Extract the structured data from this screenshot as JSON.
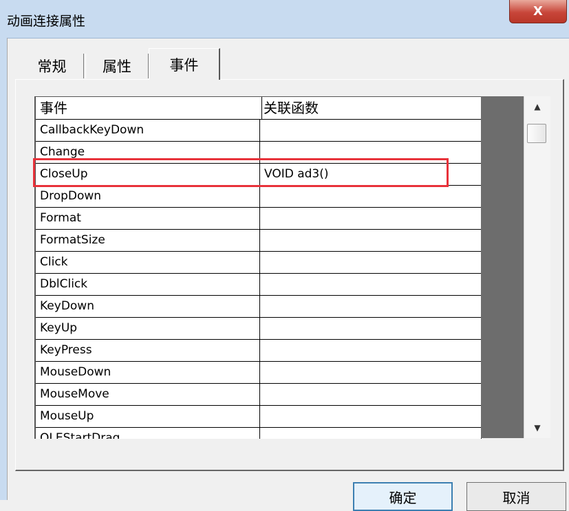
{
  "window": {
    "title": "动画连接属性",
    "close_label": "X"
  },
  "tabs": [
    {
      "label": "常规",
      "active": false
    },
    {
      "label": "属性",
      "active": false
    },
    {
      "label": "事件",
      "active": true
    }
  ],
  "grid": {
    "headers": [
      "事件",
      "关联函数"
    ],
    "rows": [
      {
        "event": "CallbackKeyDown",
        "func": ""
      },
      {
        "event": "Change",
        "func": ""
      },
      {
        "event": "CloseUp",
        "func": "VOID ad3()"
      },
      {
        "event": "DropDown",
        "func": ""
      },
      {
        "event": "Format",
        "func": ""
      },
      {
        "event": "FormatSize",
        "func": ""
      },
      {
        "event": "Click",
        "func": ""
      },
      {
        "event": "DblClick",
        "func": ""
      },
      {
        "event": "KeyDown",
        "func": ""
      },
      {
        "event": "KeyUp",
        "func": ""
      },
      {
        "event": "KeyPress",
        "func": ""
      },
      {
        "event": "MouseDown",
        "func": ""
      },
      {
        "event": "MouseMove",
        "func": ""
      },
      {
        "event": "MouseUp",
        "func": ""
      },
      {
        "event": "OLEStartDrag",
        "func": ""
      }
    ]
  },
  "scrollbar": {
    "up_icon": "arrow-up-icon",
    "down_icon": "arrow-down-icon"
  },
  "buttons": {
    "ok": "确定",
    "cancel": "取消"
  },
  "colors": {
    "highlight": "#e8323a",
    "titlebar": "#c8dbf0",
    "close": "#c8463a"
  }
}
